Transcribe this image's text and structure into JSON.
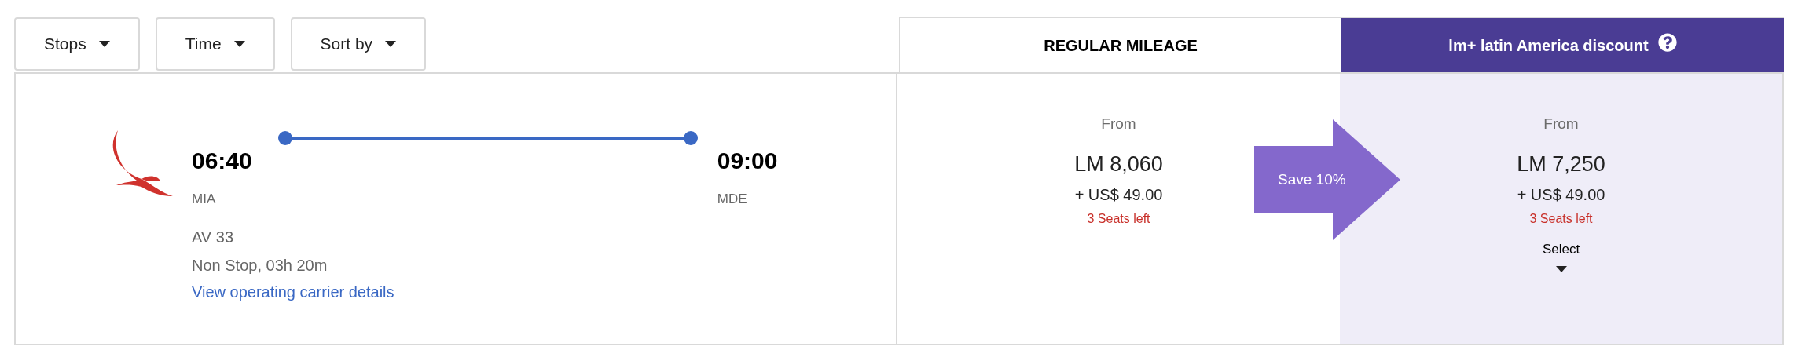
{
  "filters": [
    {
      "label": "Stops"
    },
    {
      "label": "Time"
    },
    {
      "label": "Sort by"
    }
  ],
  "flight": {
    "departure_time": "06:40",
    "departure_airport": "MIA",
    "arrival_time": "09:00",
    "arrival_airport": "MDE",
    "flight_number": "AV 33",
    "duration": "Non Stop, 03h 20m",
    "details_link": "View operating carrier details"
  },
  "fare_columns": [
    {
      "kind": "regular",
      "title": "REGULAR MILEAGE",
      "from": "From",
      "miles": "LM 8,060",
      "taxes": "+ US$ 49.00",
      "seats": "3 Seats left"
    },
    {
      "kind": "discount",
      "title": "lm+ latin America discount",
      "from": "From",
      "miles": "LM 7,250",
      "taxes": "+ US$ 49.00",
      "seats": "3 Seats left",
      "select": "Select"
    }
  ],
  "savings_badge": "Save 10%"
}
